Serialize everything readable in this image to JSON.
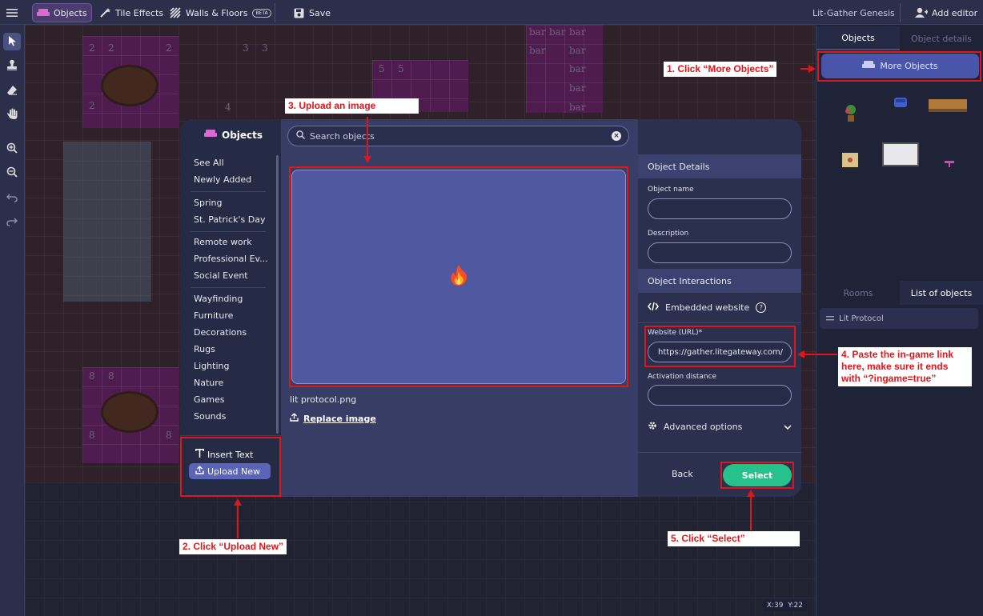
{
  "toolbar": {
    "objects": "Objects",
    "tile_effects": "Tile Effects",
    "walls_floors": "Walls & Floors",
    "beta": "BETA",
    "save": "Save",
    "space_name": "Lit-Gather Genesis",
    "add_editor": "Add editor"
  },
  "right_panel": {
    "tab_objects": "Objects",
    "tab_details": "Object details",
    "more_objects": "More Objects",
    "tab_rooms": "Rooms",
    "tab_list": "List of objects",
    "list_item": "Lit Protocol"
  },
  "canvas": {
    "coord_x": "X:39",
    "coord_y": "Y:22",
    "bar_label": "bar",
    "tile_numbers": [
      "2",
      "3",
      "4",
      "5",
      "8"
    ]
  },
  "modal": {
    "title": "Objects",
    "categories": [
      [
        "See All",
        "Newly Added"
      ],
      [
        "Spring",
        "St. Patrick's Day"
      ],
      [
        "Remote work",
        "Professional Ev...",
        "Social Event"
      ],
      [
        "Wayfinding",
        "Furniture",
        "Decorations",
        "Rugs",
        "Lighting",
        "Nature",
        "Games",
        "Sounds"
      ]
    ],
    "insert_text": "Insert Text",
    "upload_new": "Upload New",
    "search_placeholder": "Search objects",
    "file_name": "lit protocol.png",
    "replace_image": "Replace image",
    "details": {
      "header": "Object Details",
      "name_label": "Object name",
      "name_value": "",
      "description_label": "Description",
      "description_value": "",
      "interactions_header": "Object Interactions",
      "embedded_website": "Embedded website",
      "url_label": "Website (URL)*",
      "url_value": "https://gather.litegateway.com/",
      "activation_label": "Activation distance",
      "activation_value": "",
      "advanced": "Advanced options",
      "back": "Back",
      "select": "Select"
    }
  },
  "annotations": {
    "step1": "1. Click “More Objects”",
    "step2": "2. Click “Upload New”",
    "step3": "3. Upload an image",
    "step4": "4. Paste the in-game link here, make sure it ends with “?ingame=true”",
    "step5": "5. Click “Select”"
  },
  "colors": {
    "accent": "#5b65b7",
    "select_green": "#27c28b",
    "annotation_red": "#e0161b",
    "carpet_magenta": "#a42f8e"
  }
}
